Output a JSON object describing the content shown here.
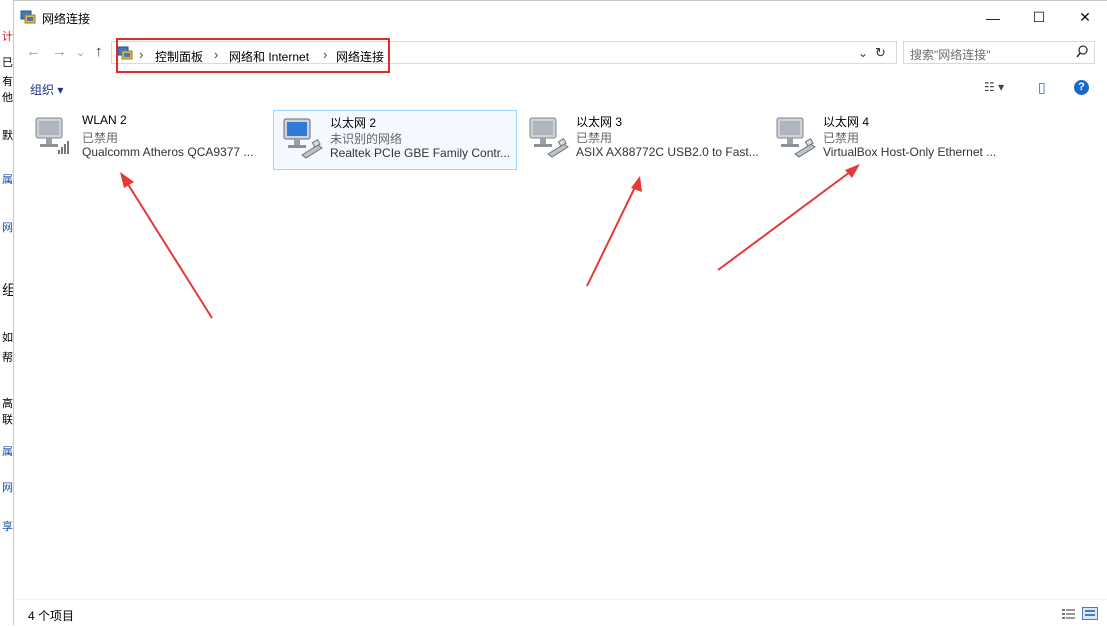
{
  "sliver": {
    "chars": [
      "计",
      "已",
      "有",
      "他",
      "默",
      "属",
      "网",
      "组",
      "如",
      "帮",
      "高",
      "联",
      "属",
      "网",
      "享"
    ]
  },
  "window": {
    "title": "网络连接",
    "controls": {
      "minimize": "—",
      "maximize": "☐",
      "close": "✕"
    }
  },
  "nav": {
    "back": "←",
    "forward": "→",
    "dropdown": "⌄",
    "up": "↑"
  },
  "address": {
    "crumbs": [
      "控制面板",
      "网络和 Internet",
      "网络连接"
    ],
    "separator": "›",
    "dropdown_glyph": "⌄",
    "refresh_glyph": "↻",
    "highlight_color": "#e02a2a"
  },
  "search": {
    "placeholder": "搜索\"网络连接\""
  },
  "command": {
    "organize": "组织 ▾"
  },
  "view": {
    "change_view": "☷ ▾",
    "preview": "▯",
    "help": "?"
  },
  "adapters": [
    {
      "name": "WLAN 2",
      "status": "已禁用",
      "device": "Qualcomm Atheros QCA9377 ...",
      "icon": "wireless-adapter-icon",
      "selected": false
    },
    {
      "name": "以太网 2",
      "status": "未识别的网络",
      "device": "Realtek PCIe GBE Family Contr...",
      "icon": "ethernet-adapter-icon",
      "selected": true
    },
    {
      "name": "以太网 3",
      "status": "已禁用",
      "device": "ASIX AX88772C USB2.0 to Fast...",
      "icon": "ethernet-adapter-icon",
      "selected": false
    },
    {
      "name": "以太网 4",
      "status": "已禁用",
      "device": "VirtualBox Host-Only Ethernet ...",
      "icon": "ethernet-adapter-icon",
      "selected": false
    }
  ],
  "status": {
    "count_text": "4 个项目"
  },
  "annotation": {
    "arrow_color": "#e53935"
  }
}
